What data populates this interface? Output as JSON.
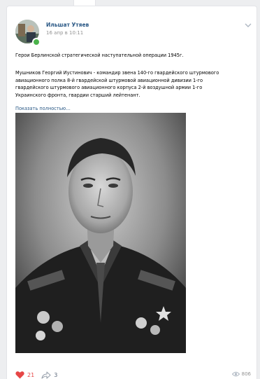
{
  "post": {
    "author": "Ильшат Утяев",
    "date": "16 апр в 10:11",
    "title_line": "Герои Берлинской стратегической наступательной операции 1945г.",
    "body_lines": [
      "Мушников Георгий Иустинович - командир звена 140-го гвардейского штурмового",
      "авиационного полка 8-й гвардейской штурмовой авиационной дивизии 1-го",
      "гвардейского штурмового авиационного корпуса 2-й воздушной армии 1-го",
      "Украинского фронта, гвардии старший лейтенант."
    ],
    "show_more": "Показать полностью…"
  },
  "footer": {
    "likes": "21",
    "shares": "3",
    "views": "806"
  },
  "icons": {
    "like": "heart-icon",
    "share": "share-arrow-icon",
    "views": "eye-icon",
    "menu": "chevron-down-icon"
  },
  "colors": {
    "link": "#2a5885",
    "like": "#e64646",
    "online": "#4bb34b",
    "muted": "#939393"
  }
}
